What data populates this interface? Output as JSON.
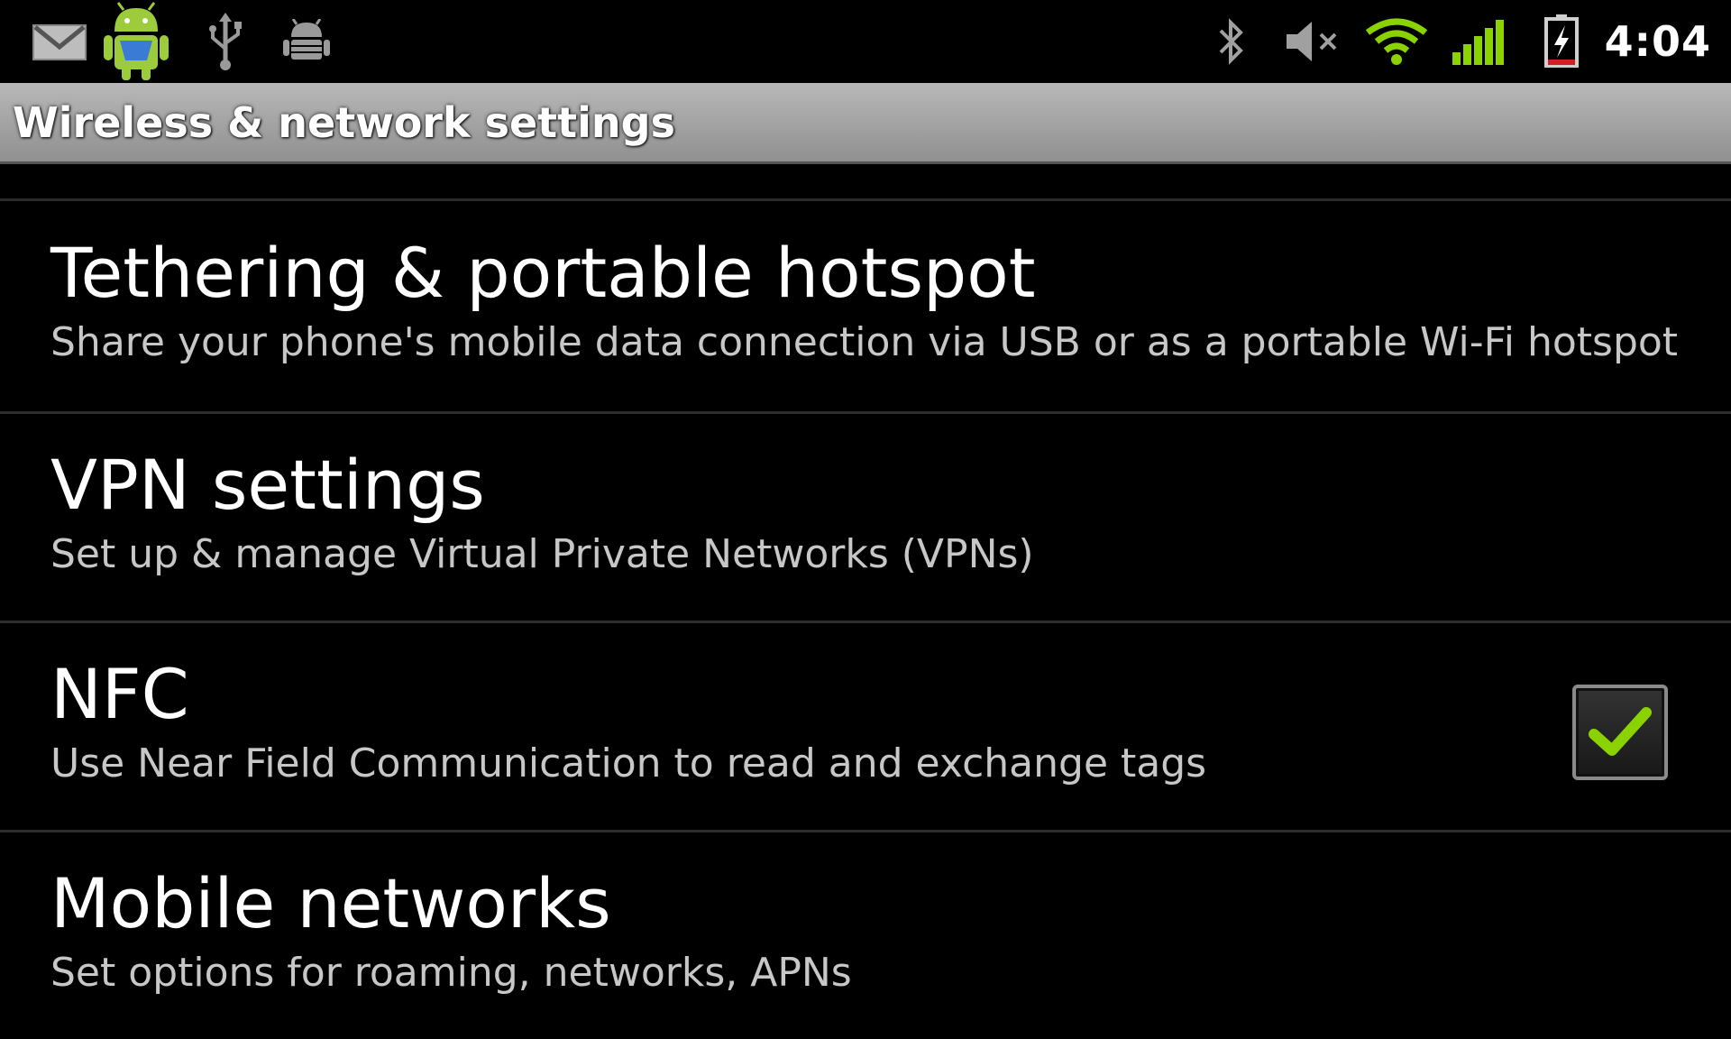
{
  "status_bar": {
    "left_icons": [
      "gmail-icon",
      "android-market-icon",
      "usb-icon",
      "usb-debugging-icon"
    ],
    "right_icons": [
      "bluetooth-icon",
      "volume-muted-icon",
      "wifi-icon",
      "signal-icon",
      "battery-charging-icon"
    ],
    "clock": "4:04",
    "colors": {
      "wifi": "#8BD300",
      "signal": "#8BD300",
      "battery_low": "#D22020"
    }
  },
  "title_bar": {
    "title": "Wireless & network settings"
  },
  "settings": [
    {
      "title": "Tethering & portable hotspot",
      "summary": "Share your phone's mobile data connection via USB or as a portable Wi-Fi hotspot"
    },
    {
      "title": "VPN settings",
      "summary": "Set up & manage Virtual Private Networks (VPNs)"
    },
    {
      "title": "NFC",
      "summary": "Use Near Field Communication to read and exchange tags",
      "checked": true
    },
    {
      "title": "Mobile networks",
      "summary": "Set options for roaming, networks, APNs"
    }
  ],
  "colors": {
    "background": "#000000",
    "title_bar": "#A6A6A6",
    "checkmark": "#8BD300"
  }
}
